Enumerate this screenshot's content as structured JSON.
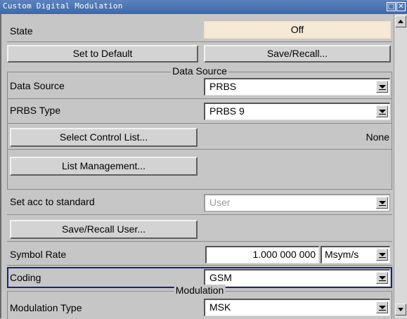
{
  "window": {
    "title": "Custom Digital Modulation"
  },
  "state": {
    "label": "State",
    "value": "Off"
  },
  "buttons": {
    "set_default": "Set to Default",
    "save_recall": "Save/Recall..."
  },
  "data_source_section": {
    "title": "Data Source",
    "data_source": {
      "label": "Data Source",
      "value": "PRBS"
    },
    "prbs_type": {
      "label": "PRBS Type",
      "value": "PRBS 9"
    },
    "select_control_list": "Select Control List...",
    "control_list_value": "None",
    "list_management": "List Management..."
  },
  "standard": {
    "label": "Set acc to standard",
    "value": "User"
  },
  "save_recall_user": "Save/Recall User...",
  "symbol_rate": {
    "label": "Symbol Rate",
    "value": "1.000 000 000",
    "unit": "Msym/s"
  },
  "coding": {
    "label": "Coding",
    "value": "GSM"
  },
  "modulation_section": {
    "title": "Modulation",
    "modulation_type": {
      "label": "Modulation Type",
      "value": "MSK"
    }
  },
  "colors": {
    "title_bar": "#3d68a9",
    "state_button": "#f6ead6",
    "focus_border": "#1a237e"
  }
}
